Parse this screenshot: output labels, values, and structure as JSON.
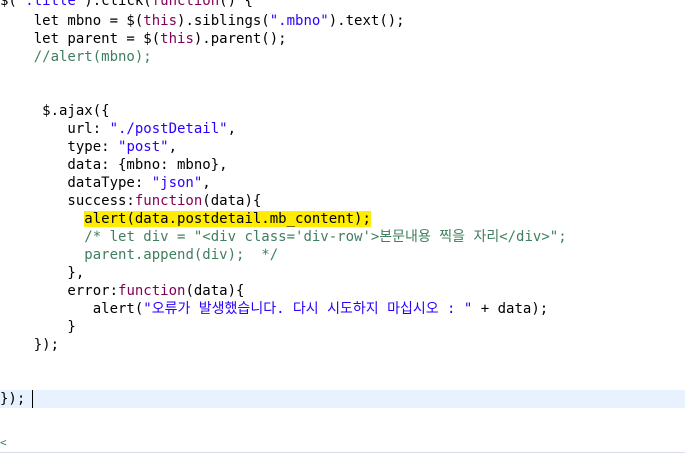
{
  "editor": {
    "line01": {
      "a": "$(",
      "b": "\".title\"",
      "c": ").click(",
      "d": "function",
      "e": "() {"
    },
    "line02": {
      "a": "    let mbno = $(",
      "b": "this",
      "c": ").siblings(",
      "d": "\".mbno\"",
      "e": ").text();"
    },
    "line03": {
      "a": "    let parent = $(",
      "b": "this",
      "c": ").parent();"
    },
    "line04": {
      "a": "    //alert(mbno);"
    },
    "line07": {
      "a": "     $.ajax({"
    },
    "line08": {
      "a": "        url: ",
      "b": "\"./postDetail\"",
      "c": ","
    },
    "line09": {
      "a": "        type: ",
      "b": "\"post\"",
      "c": ","
    },
    "line10": {
      "a": "        data: {mbno: mbno},"
    },
    "line11": {
      "a": "        dataType: ",
      "b": "\"json\"",
      "c": ","
    },
    "line12": {
      "a": "        success:",
      "b": "function",
      "c": "(data){"
    },
    "line13": {
      "indent": "          ",
      "highlighted": "alert(data.postdetail.mb_content);"
    },
    "line14": {
      "indent": "          ",
      "comment": "/* let div = \"<div class='div-row'>본문내용 찍을 자리</div>\";"
    },
    "line15": {
      "indent": "          ",
      "comment": "parent.append(div);  */"
    },
    "line16": {
      "a": "        },"
    },
    "line17": {
      "a": "        error:",
      "b": "function",
      "c": "(data){"
    },
    "line18": {
      "a": "           alert(",
      "b": "\"오류가 발생했습니다. 다시 시도하지 마십시오 : \"",
      "c": " + data);"
    },
    "line19": {
      "a": "        }"
    },
    "line20": {
      "a": "    });"
    },
    "line23": {
      "a": "});"
    },
    "line25": {
      "a": "<"
    }
  }
}
